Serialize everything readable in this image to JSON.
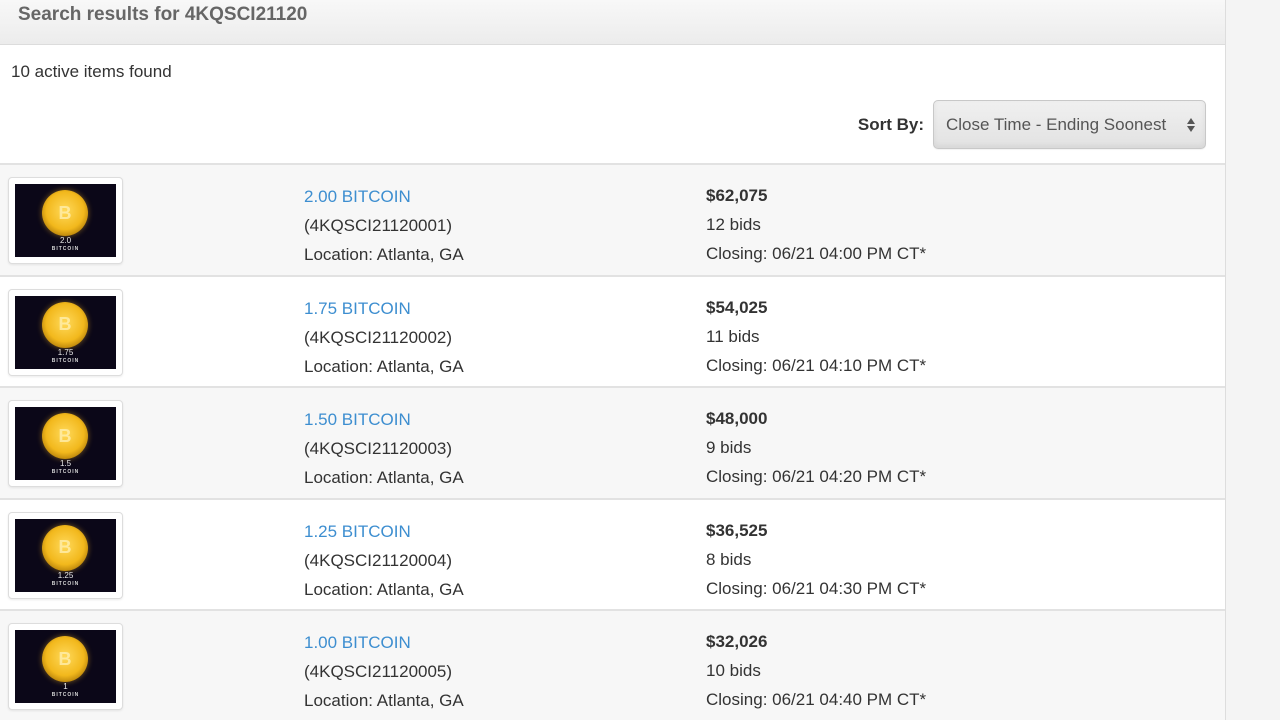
{
  "header": {
    "title": "Search results for 4KQSCI21120"
  },
  "summary": {
    "count_text": "10 active items found"
  },
  "sort": {
    "label": "Sort By:",
    "selected": "Close Time - Ending Soonest"
  },
  "results": [
    {
      "thumb_amount": "2.0",
      "thumb_caption": "BITCOIN",
      "title": "2.00 BITCOIN",
      "lot_id": "(4KQSCI21120001)",
      "location": "Location: Atlanta, GA",
      "price": "$62,075",
      "bids": "12 bids",
      "closing": "Closing: 06/21 04:00 PM CT*"
    },
    {
      "thumb_amount": "1.75",
      "thumb_caption": "BITCOIN",
      "title": "1.75 BITCOIN",
      "lot_id": "(4KQSCI21120002)",
      "location": "Location: Atlanta, GA",
      "price": "$54,025",
      "bids": "11 bids",
      "closing": "Closing: 06/21 04:10 PM CT*"
    },
    {
      "thumb_amount": "1.5",
      "thumb_caption": "BITCOIN",
      "title": "1.50 BITCOIN",
      "lot_id": "(4KQSCI21120003)",
      "location": "Location: Atlanta, GA",
      "price": "$48,000",
      "bids": "9 bids",
      "closing": "Closing: 06/21 04:20 PM CT*"
    },
    {
      "thumb_amount": "1.25",
      "thumb_caption": "BITCOIN",
      "title": "1.25 BITCOIN",
      "lot_id": "(4KQSCI21120004)",
      "location": "Location: Atlanta, GA",
      "price": "$36,525",
      "bids": "8 bids",
      "closing": "Closing: 06/21 04:30 PM CT*"
    },
    {
      "thumb_amount": "1",
      "thumb_caption": "BITCOIN",
      "title": "1.00 BITCOIN",
      "lot_id": "(4KQSCI21120005)",
      "location": "Location: Atlanta, GA",
      "price": "$32,026",
      "bids": "10 bids",
      "closing": "Closing: 06/21 04:40 PM CT*"
    }
  ],
  "icons": {
    "coin_glyph": "B"
  },
  "colors": {
    "link": "#3d8ed0",
    "alt_row": "#f7f7f7"
  }
}
